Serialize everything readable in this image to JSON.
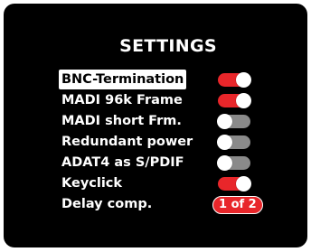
{
  "screen": {
    "title": "SETTINGS"
  },
  "settings": [
    {
      "label": "BNC-Termination",
      "state": "on",
      "selected": true
    },
    {
      "label": "MADI 96k Frame",
      "state": "on",
      "selected": false
    },
    {
      "label": "MADI short Frm.",
      "state": "off",
      "selected": false
    },
    {
      "label": "Redundant power",
      "state": "off",
      "selected": false
    },
    {
      "label": "ADAT4 as S/PDIF",
      "state": "off",
      "selected": false
    },
    {
      "label": "Keyclick",
      "state": "on",
      "selected": false
    },
    {
      "label": "Delay comp.",
      "value": "1 of 2",
      "selected": false
    }
  ],
  "colors": {
    "background": "#000000",
    "toggle_on": "#e8262a",
    "toggle_off": "#8a8a8a",
    "text": "#ffffff"
  },
  "icons": {
    "toggle": "toggle-switch-icon"
  }
}
